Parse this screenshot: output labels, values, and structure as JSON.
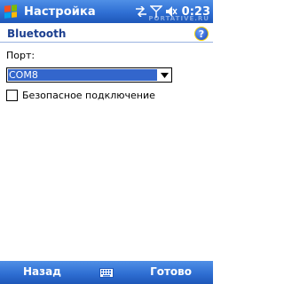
{
  "titlebar": {
    "title": "Настройка",
    "clock": "0:23",
    "watermark": "PORTATIVE.RU",
    "icons": [
      "windows-start-icon",
      "connectivity-icon",
      "signal-icon",
      "volume-icon"
    ]
  },
  "header": {
    "title": "Bluetooth",
    "help_icon_glyph": "?"
  },
  "form": {
    "port_label": "Порт:",
    "port_value": "COM8",
    "secure_label": "Безопасное подключение",
    "secure_checked": false
  },
  "bottombar": {
    "left_softkey": "Назад",
    "right_softkey": "Готово",
    "center_icon": "keyboard-icon"
  },
  "colors": {
    "bar_blue": "#2f6fd3",
    "title_text": "#1c3f8f",
    "selection": "#3366cc"
  }
}
